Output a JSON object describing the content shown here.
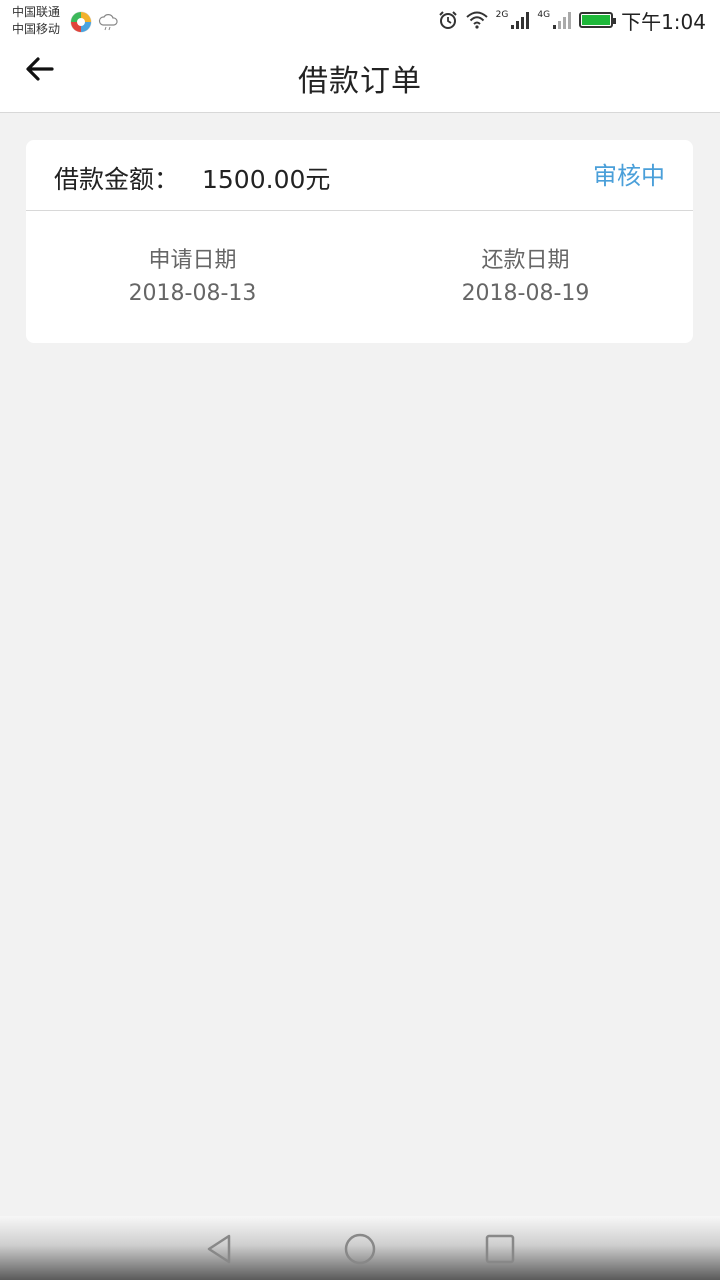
{
  "statusbar": {
    "carrier_line1": "中国联通",
    "carrier_line2": "中国移动",
    "net1": "2G",
    "net2": "4G",
    "time": "下午1:04",
    "battery_level": 100
  },
  "appbar": {
    "title": "借款订单"
  },
  "order": {
    "amount_label": "借款金额：",
    "amount_value": "1500.00元",
    "status": "审核中",
    "status_color": "#4a9fd9",
    "apply_label": "申请日期",
    "apply_date": "2018-08-13",
    "repay_label": "还款日期",
    "repay_date": "2018-08-19"
  },
  "navbar": {
    "icons": [
      "back-triangle-icon",
      "home-circle-icon",
      "recents-square-icon"
    ]
  }
}
